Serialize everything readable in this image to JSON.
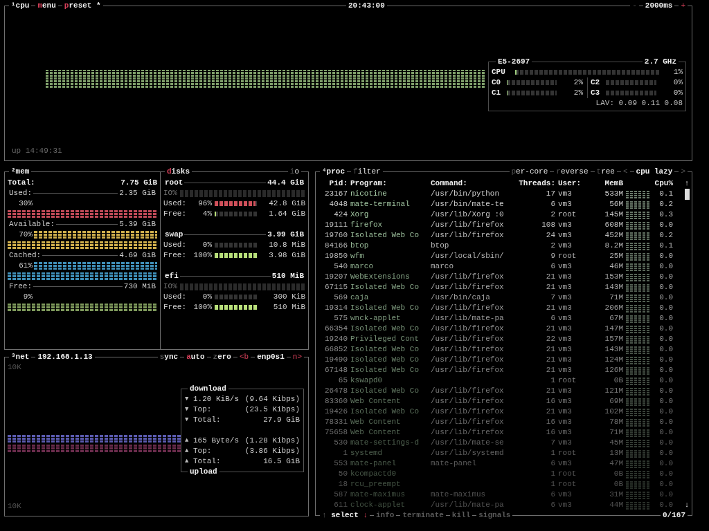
{
  "cpu_box": {
    "title": "¹cpu",
    "tabs": [
      {
        "label": "menu",
        "hotkey": true
      },
      {
        "label": "preset *",
        "hotkey": true
      }
    ],
    "clock": "20:43:00",
    "interval": {
      "minus": "-",
      "value": "2000ms",
      "plus": "+"
    },
    "uptime": "up 14:49:31",
    "info": {
      "model": "E5-2697",
      "frequency": "2.7 GHz",
      "total": {
        "label": "CPU",
        "level": 0.01,
        "reading": "1%"
      },
      "cores": [
        {
          "label": "C0",
          "level": 0.02,
          "reading": "2%"
        },
        {
          "label": "C2",
          "level": 0.0,
          "reading": "0%"
        },
        {
          "label": "C1",
          "level": 0.02,
          "reading": "2%"
        },
        {
          "label": "C3",
          "level": 0.0,
          "reading": "0%"
        }
      ],
      "load": "LAV: 0.09 0.11 0.08"
    }
  },
  "mem_box": {
    "title": "²mem",
    "total": {
      "label": "Total:",
      "value": "7.75 GiB"
    },
    "items": [
      {
        "label": "Used:",
        "value": "2.35 GiB",
        "percent": "30%",
        "graph_high": false,
        "color": "#c04a58"
      },
      {
        "label": "Available:",
        "value": "5.39 GiB",
        "percent": "70%",
        "graph_high": true,
        "color": "#cfae4c"
      },
      {
        "label": "Cached:",
        "value": "4.69 GiB",
        "percent": "61%",
        "graph_high": true,
        "color": "#3f8fb8"
      },
      {
        "label": "Free:",
        "value": "730 MiB",
        "percent": "9%",
        "graph_high": false,
        "color": "#7f9a5c"
      }
    ]
  },
  "disks_box": {
    "title": {
      "label": "disks",
      "hotkey": true
    },
    "io_toggle": {
      "label": "io",
      "hotkey": false
    },
    "disks": [
      {
        "name": "root",
        "size": "44.4 GiB",
        "io": "IO%",
        "used": {
          "label": "Used:",
          "percent": "96%",
          "level": 0.96,
          "value": "42.8 GiB"
        },
        "free": {
          "label": "Free:",
          "percent": "4%",
          "level": 0.04,
          "value": "1.64 GiB"
        }
      },
      {
        "name": "swap",
        "size": "3.99 GiB",
        "used": {
          "label": "Used:",
          "percent": "0%",
          "level": 0.0,
          "value": "10.8 MiB"
        },
        "free": {
          "label": "Free:",
          "percent": "100%",
          "level": 1.0,
          "value": "3.98 GiB"
        }
      },
      {
        "name": "efi",
        "size": "510 MiB",
        "io": "IO%",
        "used": {
          "label": "Used:",
          "percent": "0%",
          "level": 0.0,
          "value": "300 KiB"
        },
        "free": {
          "label": "Free:",
          "percent": "100%",
          "level": 1.0,
          "value": "510 MiB"
        }
      }
    ]
  },
  "net_box": {
    "title": "³net",
    "address": "192.168.1.13",
    "toggles": [
      {
        "label": "sync",
        "hotkey": false
      },
      {
        "label": "auto",
        "hotkey": true
      },
      {
        "label": "zero",
        "hotkey": false
      }
    ],
    "interface": {
      "previous": "<b",
      "name": "enp0s1",
      "next": "n>"
    },
    "scale_top": "10K",
    "scale_bottom": "10K",
    "download": {
      "title": "download",
      "rows": [
        {
          "arrow": "▼",
          "label": "1.20 KiB/s",
          "value": "(9.64 Kibps)"
        },
        {
          "arrow": "▼",
          "label": "Top:",
          "value": "(23.5 Kibps)"
        },
        {
          "arrow": "▼",
          "label": "Total:",
          "value": "27.9 GiB"
        }
      ]
    },
    "upload": {
      "title": "upload",
      "rows": [
        {
          "arrow": "▲",
          "label": "165 Byte/s",
          "value": "(1.28 Kibps)"
        },
        {
          "arrow": "▲",
          "label": "Top:",
          "value": "(3.86 Kibps)"
        },
        {
          "arrow": "▲",
          "label": "Total:",
          "value": "16.5 GiB"
        }
      ]
    }
  },
  "proc_box": {
    "title": "⁴proc",
    "filter": {
      "label": "filter",
      "hotkey": false
    },
    "options": [
      {
        "label": "per-core",
        "hotkey": false
      },
      {
        "label": "reverse",
        "hotkey": false
      },
      {
        "label": "tree",
        "hotkey": false
      }
    ],
    "sort": {
      "previous": "<",
      "label": "cpu lazy",
      "next": ">"
    },
    "columns": [
      "Pid:",
      "Program:",
      "Command:",
      "Threads:",
      "User:",
      "MemB",
      "Cpu%"
    ],
    "scroll_up": "↑",
    "scroll_down": "↓",
    "rows": [
      {
        "pid": "23167",
        "program": "nicotine",
        "command": "/usr/bin/python",
        "threads": "17",
        "user": "vm3",
        "mem": "533M",
        "cpu": "0.1"
      },
      {
        "pid": "4048",
        "program": "mate-terminal",
        "command": "/usr/bin/mate-te",
        "threads": "6",
        "user": "vm3",
        "mem": "56M",
        "cpu": "0.2"
      },
      {
        "pid": "424",
        "program": "Xorg",
        "command": "/usr/lib/Xorg :0",
        "threads": "2",
        "user": "root",
        "mem": "145M",
        "cpu": "0.3"
      },
      {
        "pid": "19111",
        "program": "firefox",
        "command": "/usr/lib/firefox",
        "threads": "108",
        "user": "vm3",
        "mem": "608M",
        "cpu": "0.0"
      },
      {
        "pid": "19760",
        "program": "Isolated Web Co",
        "command": "/usr/lib/firefox",
        "threads": "24",
        "user": "vm3",
        "mem": "452M",
        "cpu": "0.2"
      },
      {
        "pid": "84166",
        "program": "btop",
        "command": "btop",
        "threads": "2",
        "user": "vm3",
        "mem": "8.2M",
        "cpu": "0.1"
      },
      {
        "pid": "19850",
        "program": "wfm",
        "command": "/usr/local/sbin/",
        "threads": "9",
        "user": "root",
        "mem": "25M",
        "cpu": "0.0"
      },
      {
        "pid": "540",
        "program": "marco",
        "command": "marco",
        "threads": "6",
        "user": "vm3",
        "mem": "46M",
        "cpu": "0.0"
      },
      {
        "pid": "19207",
        "program": "WebExtensions",
        "command": "/usr/lib/firefox",
        "threads": "21",
        "user": "vm3",
        "mem": "153M",
        "cpu": "0.0"
      },
      {
        "pid": "67115",
        "program": "Isolated Web Co",
        "command": "/usr/lib/firefox",
        "threads": "21",
        "user": "vm3",
        "mem": "143M",
        "cpu": "0.0"
      },
      {
        "pid": "569",
        "program": "caja",
        "command": "/usr/bin/caja",
        "threads": "7",
        "user": "vm3",
        "mem": "71M",
        "cpu": "0.0"
      },
      {
        "pid": "19314",
        "program": "Isolated Web Co",
        "command": "/usr/lib/firefox",
        "threads": "21",
        "user": "vm3",
        "mem": "206M",
        "cpu": "0.0"
      },
      {
        "pid": "575",
        "program": "wnck-applet",
        "command": "/usr/lib/mate-pa",
        "threads": "6",
        "user": "vm3",
        "mem": "67M",
        "cpu": "0.0"
      },
      {
        "pid": "66354",
        "program": "Isolated Web Co",
        "command": "/usr/lib/firefox",
        "threads": "21",
        "user": "vm3",
        "mem": "147M",
        "cpu": "0.0"
      },
      {
        "pid": "19240",
        "program": "Privileged Cont",
        "command": "/usr/lib/firefox",
        "threads": "22",
        "user": "vm3",
        "mem": "157M",
        "cpu": "0.0"
      },
      {
        "pid": "66852",
        "program": "Isolated Web Co",
        "command": "/usr/lib/firefox",
        "threads": "21",
        "user": "vm3",
        "mem": "143M",
        "cpu": "0.0"
      },
      {
        "pid": "19490",
        "program": "Isolated Web Co",
        "command": "/usr/lib/firefox",
        "threads": "21",
        "user": "vm3",
        "mem": "124M",
        "cpu": "0.0"
      },
      {
        "pid": "67148",
        "program": "Isolated Web Co",
        "command": "/usr/lib/firefox",
        "threads": "21",
        "user": "vm3",
        "mem": "126M",
        "cpu": "0.0"
      },
      {
        "pid": "65",
        "program": "kswapd0",
        "threads": "1",
        "user": "root",
        "mem": "0B",
        "cpu": "0.0"
      },
      {
        "pid": "26478",
        "program": "Isolated Web Co",
        "command": "/usr/lib/firefox",
        "threads": "21",
        "user": "vm3",
        "mem": "121M",
        "cpu": "0.0"
      },
      {
        "pid": "83360",
        "program": "Web Content",
        "command": "/usr/lib/firefox",
        "threads": "16",
        "user": "vm3",
        "mem": "69M",
        "cpu": "0.0"
      },
      {
        "pid": "19426",
        "program": "Isolated Web Co",
        "command": "/usr/lib/firefox",
        "threads": "21",
        "user": "vm3",
        "mem": "102M",
        "cpu": "0.0"
      },
      {
        "pid": "78331",
        "program": "Web Content",
        "command": "/usr/lib/firefox",
        "threads": "16",
        "user": "vm3",
        "mem": "78M",
        "cpu": "0.0"
      },
      {
        "pid": "75658",
        "program": "Web Content",
        "command": "/usr/lib/firefox",
        "threads": "16",
        "user": "vm3",
        "mem": "71M",
        "cpu": "0.0"
      },
      {
        "pid": "530",
        "program": "mate-settings-d",
        "command": "/usr/lib/mate-se",
        "threads": "7",
        "user": "vm3",
        "mem": "45M",
        "cpu": "0.0"
      },
      {
        "pid": "1",
        "program": "systemd",
        "command": "/usr/lib/systemd",
        "threads": "1",
        "user": "root",
        "mem": "13M",
        "cpu": "0.0"
      },
      {
        "pid": "553",
        "program": "mate-panel",
        "command": "mate-panel",
        "threads": "6",
        "user": "vm3",
        "mem": "47M",
        "cpu": "0.0"
      },
      {
        "pid": "50",
        "program": "kcompactd0",
        "threads": "1",
        "user": "root",
        "mem": "0B",
        "cpu": "0.0"
      },
      {
        "pid": "18",
        "program": "rcu_preempt",
        "threads": "1",
        "user": "root",
        "mem": "0B",
        "cpu": "0.0"
      },
      {
        "pid": "587",
        "program": "mate-maximus",
        "command": "mate-maximus",
        "threads": "6",
        "user": "vm3",
        "mem": "31M",
        "cpu": "0.0"
      },
      {
        "pid": "611",
        "program": "clock-applet",
        "command": "/usr/lib/mate-pa",
        "threads": "6",
        "user": "vm3",
        "mem": "44M",
        "cpu": "0.0"
      }
    ],
    "footer": {
      "select": {
        "up": "↑",
        "label": "select",
        "down": "↓"
      },
      "actions": [
        {
          "label": "info",
          "disabled": true
        },
        {
          "label": "terminate",
          "disabled": true
        },
        {
          "label": "kill",
          "disabled": true
        },
        {
          "label": "signals",
          "disabled": true
        }
      ],
      "count": "0/167"
    }
  }
}
